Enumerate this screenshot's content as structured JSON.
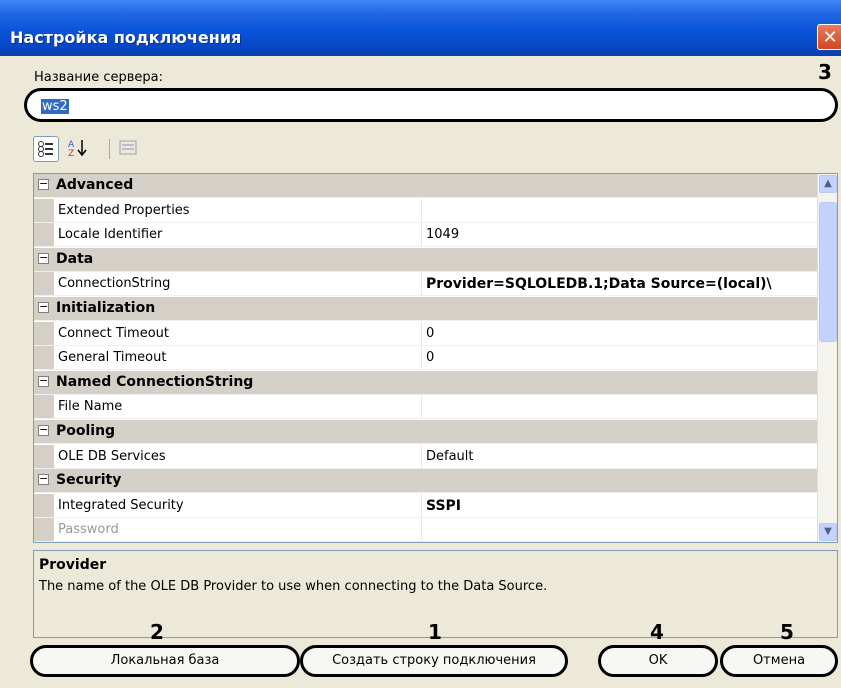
{
  "window": {
    "title": "Настройка подключения"
  },
  "server": {
    "label": "Название сервера:",
    "value": "ws2"
  },
  "toolbar": {
    "categorized_icon": "categorized-view-icon",
    "alphabetical_icon": "alphabetical-sort-icon",
    "property_pages_icon": "property-pages-icon"
  },
  "grid": {
    "rows": [
      {
        "type": "category",
        "label": "Advanced"
      },
      {
        "type": "property",
        "name": "Extended Properties",
        "value": ""
      },
      {
        "type": "property",
        "name": "Locale Identifier",
        "value": "1049"
      },
      {
        "type": "category",
        "label": "Data"
      },
      {
        "type": "property",
        "name": "ConnectionString",
        "value": "Provider=SQLOLEDB.1;Data Source=(local)\\",
        "bold": true
      },
      {
        "type": "category",
        "label": "Initialization"
      },
      {
        "type": "property",
        "name": "Connect Timeout",
        "value": "0"
      },
      {
        "type": "property",
        "name": "General Timeout",
        "value": "0"
      },
      {
        "type": "category",
        "label": "Named ConnectionString"
      },
      {
        "type": "property",
        "name": "File Name",
        "value": ""
      },
      {
        "type": "category",
        "label": "Pooling"
      },
      {
        "type": "property",
        "name": "OLE DB Services",
        "value": "Default"
      },
      {
        "type": "category",
        "label": "Security"
      },
      {
        "type": "property",
        "name": "Integrated Security",
        "value": "SSPI",
        "bold": true
      },
      {
        "type": "property",
        "name": "Password",
        "value": "",
        "disabled": true
      }
    ]
  },
  "help": {
    "title": "Provider",
    "description": "The name of the OLE DB Provider to use when connecting to the Data Source."
  },
  "buttons": {
    "local_db": "Локальная база",
    "create_conn": "Создать строку подключения",
    "ok": "OK",
    "cancel": "Отмена"
  },
  "callouts": {
    "c1": "1",
    "c2": "2",
    "c3": "3",
    "c4": "4",
    "c5": "5"
  }
}
